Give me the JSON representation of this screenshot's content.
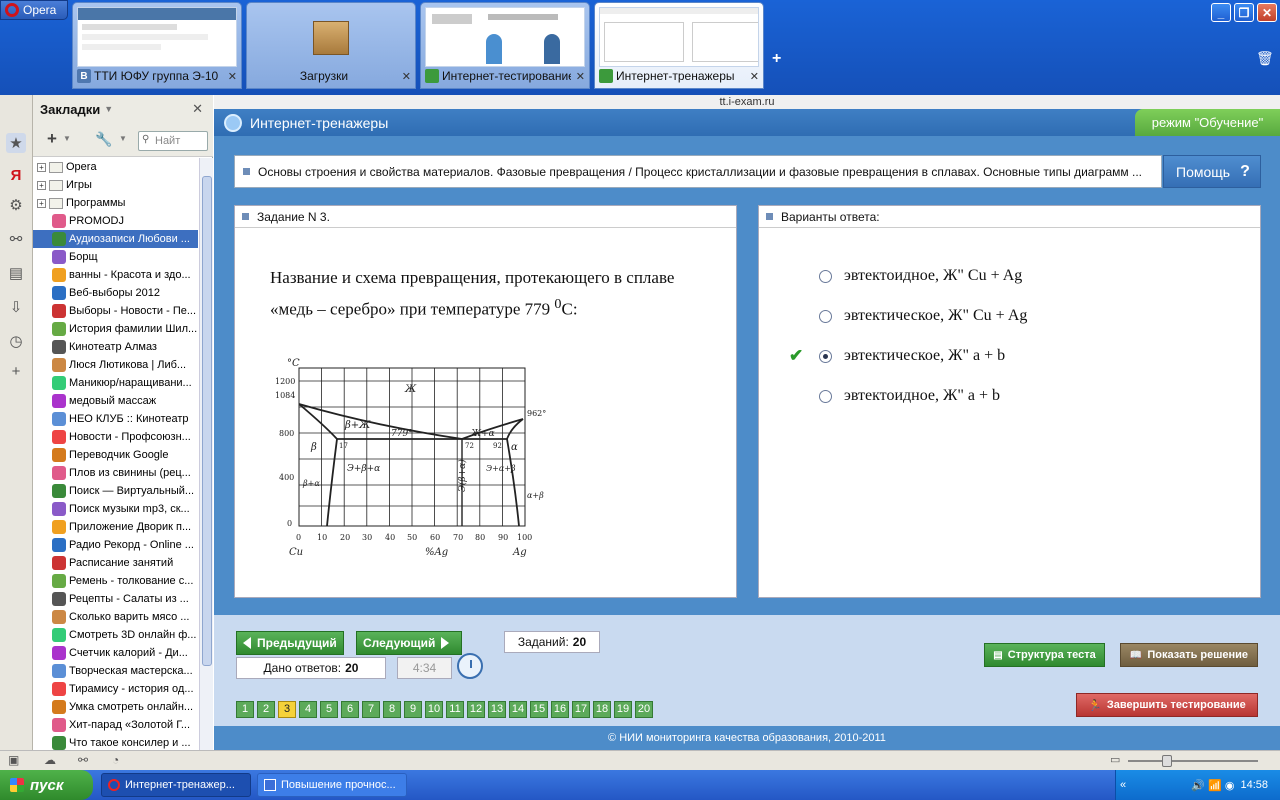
{
  "browser": {
    "opera_label": "Opera",
    "url": "tt.i-exam.ru",
    "tabs": [
      {
        "label": "ТТИ ЮФУ группа Э-10",
        "favicon": "В"
      },
      {
        "label": "Загрузки"
      },
      {
        "label": "Интернет-тестирование"
      },
      {
        "label": "Интернет-тренажеры"
      }
    ],
    "close_glyph": "✕"
  },
  "bookmarks": {
    "title": "Закладки",
    "search_placeholder": "Найт",
    "items": [
      {
        "label": "Opera",
        "type": "folder"
      },
      {
        "label": "Игры",
        "type": "folder"
      },
      {
        "label": "Программы",
        "type": "folder"
      },
      {
        "label": "PROMODJ",
        "type": "link"
      },
      {
        "label": "Аудиозаписи Любови ...",
        "type": "link",
        "selected": true
      },
      {
        "label": "Борщ",
        "type": "link"
      },
      {
        "label": "ванны - Красота и здо...",
        "type": "link"
      },
      {
        "label": "Веб-выборы 2012",
        "type": "link"
      },
      {
        "label": "Выборы - Новости - Пе...",
        "type": "link"
      },
      {
        "label": "История фамилии Шил...",
        "type": "link"
      },
      {
        "label": "Кинотеатр Алмаз",
        "type": "link"
      },
      {
        "label": "Люся Лютикова | Либ...",
        "type": "link"
      },
      {
        "label": "Маникюр/наращивани...",
        "type": "link"
      },
      {
        "label": "медовый массаж",
        "type": "link"
      },
      {
        "label": "НЕО КЛУБ :: Кинотеатр",
        "type": "link"
      },
      {
        "label": "Новости - Профсоюзн...",
        "type": "link"
      },
      {
        "label": "Переводчик Google",
        "type": "link"
      },
      {
        "label": "Плов из свинины (рец...",
        "type": "link"
      },
      {
        "label": "Поиск — Виртуальный...",
        "type": "link"
      },
      {
        "label": "Поиск музыки mp3, ск...",
        "type": "link"
      },
      {
        "label": "Приложение Дворик п...",
        "type": "link"
      },
      {
        "label": "Радио Рекорд - Online ...",
        "type": "link"
      },
      {
        "label": "Расписание занятий",
        "type": "link"
      },
      {
        "label": "Ремень - толкование с...",
        "type": "link"
      },
      {
        "label": "Рецепты - Салаты из ...",
        "type": "link"
      },
      {
        "label": "Сколько варить мясо ...",
        "type": "link"
      },
      {
        "label": "Смотреть 3D онлайн ф...",
        "type": "link"
      },
      {
        "label": "Счетчик калорий - Ди...",
        "type": "link"
      },
      {
        "label": "Творческая мастерска...",
        "type": "link"
      },
      {
        "label": "Тирамису - история од...",
        "type": "link"
      },
      {
        "label": "Умка смотреть онлайн...",
        "type": "link"
      },
      {
        "label": "Хит-парад «Золотой Г...",
        "type": "link"
      },
      {
        "label": "Что такое консилер и ...",
        "type": "link"
      }
    ]
  },
  "app": {
    "title": "Интернет-тренажеры",
    "mode": "режим \"Обучение\"",
    "breadcrumb": "Основы строения и свойства материалов. Фазовые превращения / Процесс кристаллизации и фазовые превращения в сплавах. Основные типы диаграмм ...",
    "help_label": "Помощь",
    "help_glyph": "?",
    "task_header": "Задание N 3.",
    "answers_header": "Варианты ответа:",
    "question_main": "Название и схема превращения, протекающего в сплаве «медь – серебро» при температуре 779 ",
    "question_sup": "0",
    "question_unit": "С:",
    "answers": [
      {
        "text": "эвтектоидное, Ж\" Cu + Ag",
        "selected": false
      },
      {
        "text": "эвтектическое, Ж\" Cu + Ag",
        "selected": false
      },
      {
        "text": "эвтектическое, Ж\" a + b",
        "selected": true,
        "correct": true
      },
      {
        "text": "эвтектоидное, Ж\" a + b",
        "selected": false
      }
    ],
    "check_glyph": "✔"
  },
  "diagram": {
    "y_unit": "°C",
    "y_ticks": [
      "1200",
      "1084",
      "800",
      "400",
      "0"
    ],
    "x_ticks": [
      "0",
      "10",
      "20",
      "30",
      "40",
      "50",
      "60",
      "70",
      "80",
      "90",
      "100"
    ],
    "x_left": "Cu",
    "x_right": "Ag",
    "x_axis_label": "%Ag",
    "labels": {
      "liquid": "Ж",
      "beta_liquid": "β+Ж",
      "liquid_alpha": "Ж+α",
      "beta": "β",
      "alpha": "α",
      "eutectic_temp": "779°",
      "ag_melt": "962°",
      "left_comp": "17",
      "eut_comp": "72",
      "right_comp": "92",
      "left_region": "Э+β+α",
      "mid_region": "Э(β+α)",
      "right_region": "Э+α+β",
      "beta_alpha": "β+α",
      "alpha_beta": "α+β"
    }
  },
  "nav": {
    "prev": "Предыдущий",
    "next": "Следующий",
    "tasks_label": "Заданий:",
    "tasks_count": "20",
    "answered_label": "Дано ответов:",
    "answered_count": "20",
    "timer": "4:34",
    "pages": [
      "1",
      "2",
      "3",
      "4",
      "5",
      "6",
      "7",
      "8",
      "9",
      "10",
      "11",
      "12",
      "13",
      "14",
      "15",
      "16",
      "17",
      "18",
      "19",
      "20"
    ],
    "current_page": "3",
    "structure_btn": "Структура теста",
    "solution_btn": "Показать решение",
    "finish_btn": "Завершить тестирование",
    "footer": "© НИИ мониторинга качества образования, 2010-2011"
  },
  "taskbar": {
    "start": "пуск",
    "tasks": [
      "Интернет-тренажер...",
      "Повышение прочнос..."
    ],
    "clock": "14:58"
  },
  "colors": {
    "accent": "#4d8cc9",
    "header": "#2f6db3",
    "mode_green": "#58a93e",
    "nav_green": "#2f8a2f",
    "finish_red": "#c9403e",
    "solution_brown": "#7c6a48"
  }
}
